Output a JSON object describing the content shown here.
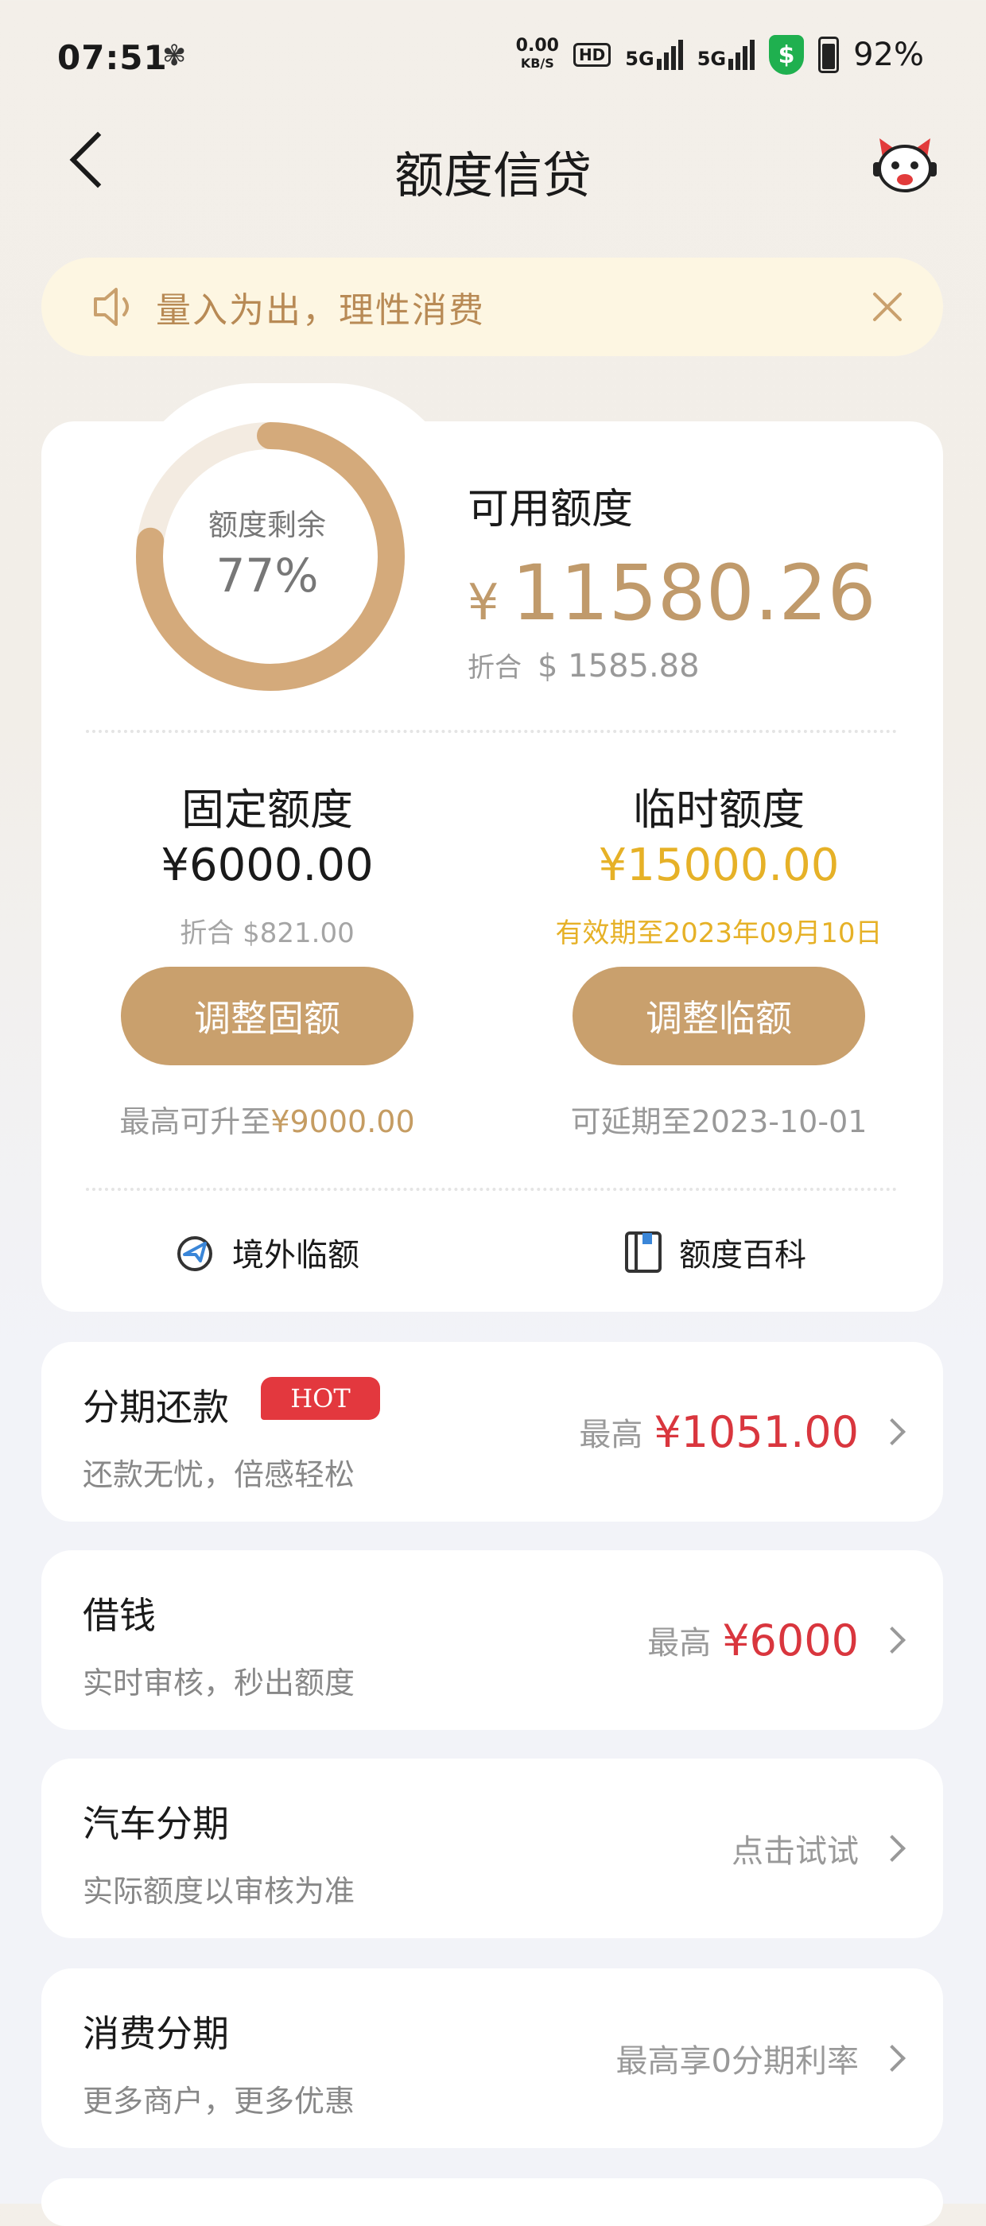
{
  "status_bar": {
    "time": "07:51",
    "net_speed_value": "0.00",
    "net_speed_unit": "KB/S",
    "hd_badge": "HD",
    "signal1_label": "5G",
    "signal2_label": "5G",
    "shield_symbol": "$",
    "battery": "92%"
  },
  "header": {
    "title": "额度信贷"
  },
  "notice": {
    "text": "量入为出，理性消费"
  },
  "credit_summary": {
    "remaining_label": "额度剩余",
    "remaining_percent": "77%",
    "remaining_fraction": 0.77,
    "available_label": "可用额度",
    "currency_symbol": "¥",
    "available_amount": "11580.26",
    "converted_label": "折合",
    "converted_amount": "$ 1585.88"
  },
  "fixed_limit": {
    "title": "固定额度",
    "amount": "¥6000.00",
    "converted": "折合 $821.00",
    "button_label": "调整固额",
    "note_prefix": "最高可升至",
    "note_value": "¥9000.00"
  },
  "temp_limit": {
    "title": "临时额度",
    "amount": "¥15000.00",
    "validity": "有效期至2023年09月10日",
    "button_label": "调整临额",
    "note": "可延期至2023-10-01"
  },
  "links": {
    "overseas": "境外临额",
    "encyclopedia": "额度百科"
  },
  "services": [
    {
      "title": "分期还款",
      "badge": "HOT",
      "subtitle": "还款无忧，倍感轻松",
      "right_label": "最高",
      "right_value": "¥1051.00"
    },
    {
      "title": "借钱",
      "subtitle": "实时审核，秒出额度",
      "right_label": "最高",
      "right_value": "¥6000"
    },
    {
      "title": "汽车分期",
      "subtitle": "实际额度以审核为准",
      "right_label": "点击试试"
    },
    {
      "title": "消费分期",
      "subtitle": "更多商户，更多优惠",
      "right_label": "最高享0分期利率"
    }
  ],
  "colors": {
    "accent_gold": "#c9a06d",
    "amount_gold": "#c09a6b",
    "temp_yellow": "#e6b127",
    "hot_red": "#e3383e",
    "value_red": "#d9363e",
    "notice_bg": "#fdf6e2"
  },
  "icons": {
    "back": "chevron-left-icon",
    "mascot": "mascot-icon",
    "speaker": "speaker-icon",
    "close": "close-icon",
    "overseas": "airplane-globe-icon",
    "encyclopedia": "book-icon",
    "chevron": "chevron-right-icon"
  }
}
